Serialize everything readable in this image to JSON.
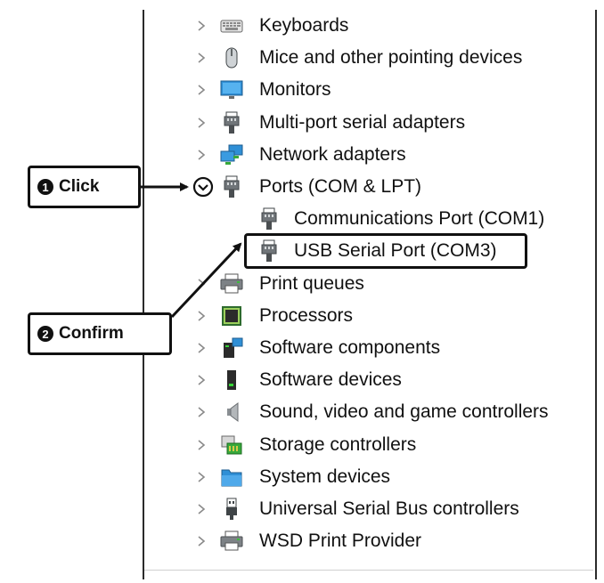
{
  "device_tree": {
    "items": [
      {
        "label": "Keyboards",
        "icon": "keyboard-icon",
        "expanded": false
      },
      {
        "label": "Mice and other pointing devices",
        "icon": "mouse-icon",
        "expanded": false
      },
      {
        "label": "Monitors",
        "icon": "monitor-icon",
        "expanded": false
      },
      {
        "label": "Multi-port serial adapters",
        "icon": "serial-port-icon",
        "expanded": false
      },
      {
        "label": "Network adapters",
        "icon": "network-icon",
        "expanded": false
      },
      {
        "label": "Ports (COM & LPT)",
        "icon": "serial-port-icon",
        "expanded": true,
        "children": [
          {
            "label": "Communications Port (COM1)",
            "icon": "serial-port-icon"
          },
          {
            "label": "USB Serial Port (COM3)",
            "icon": "serial-port-icon"
          }
        ]
      },
      {
        "label": "Print queues",
        "icon": "printer-icon",
        "expanded": false
      },
      {
        "label": "Processors",
        "icon": "processor-icon",
        "expanded": false
      },
      {
        "label": "Software components",
        "icon": "software-component-icon",
        "expanded": false
      },
      {
        "label": "Software devices",
        "icon": "software-device-icon",
        "expanded": false
      },
      {
        "label": "Sound, video and game controllers",
        "icon": "speaker-icon",
        "expanded": false
      },
      {
        "label": "Storage controllers",
        "icon": "storage-icon",
        "expanded": false
      },
      {
        "label": "System devices",
        "icon": "system-folder-icon",
        "expanded": false
      },
      {
        "label": "Universal Serial Bus controllers",
        "icon": "usb-icon",
        "expanded": false
      },
      {
        "label": "WSD Print Provider",
        "icon": "printer-icon",
        "expanded": false
      }
    ]
  },
  "callouts": {
    "click": {
      "number": "1",
      "text": "Click"
    },
    "confirm": {
      "number": "2",
      "text": "Confirm"
    }
  }
}
